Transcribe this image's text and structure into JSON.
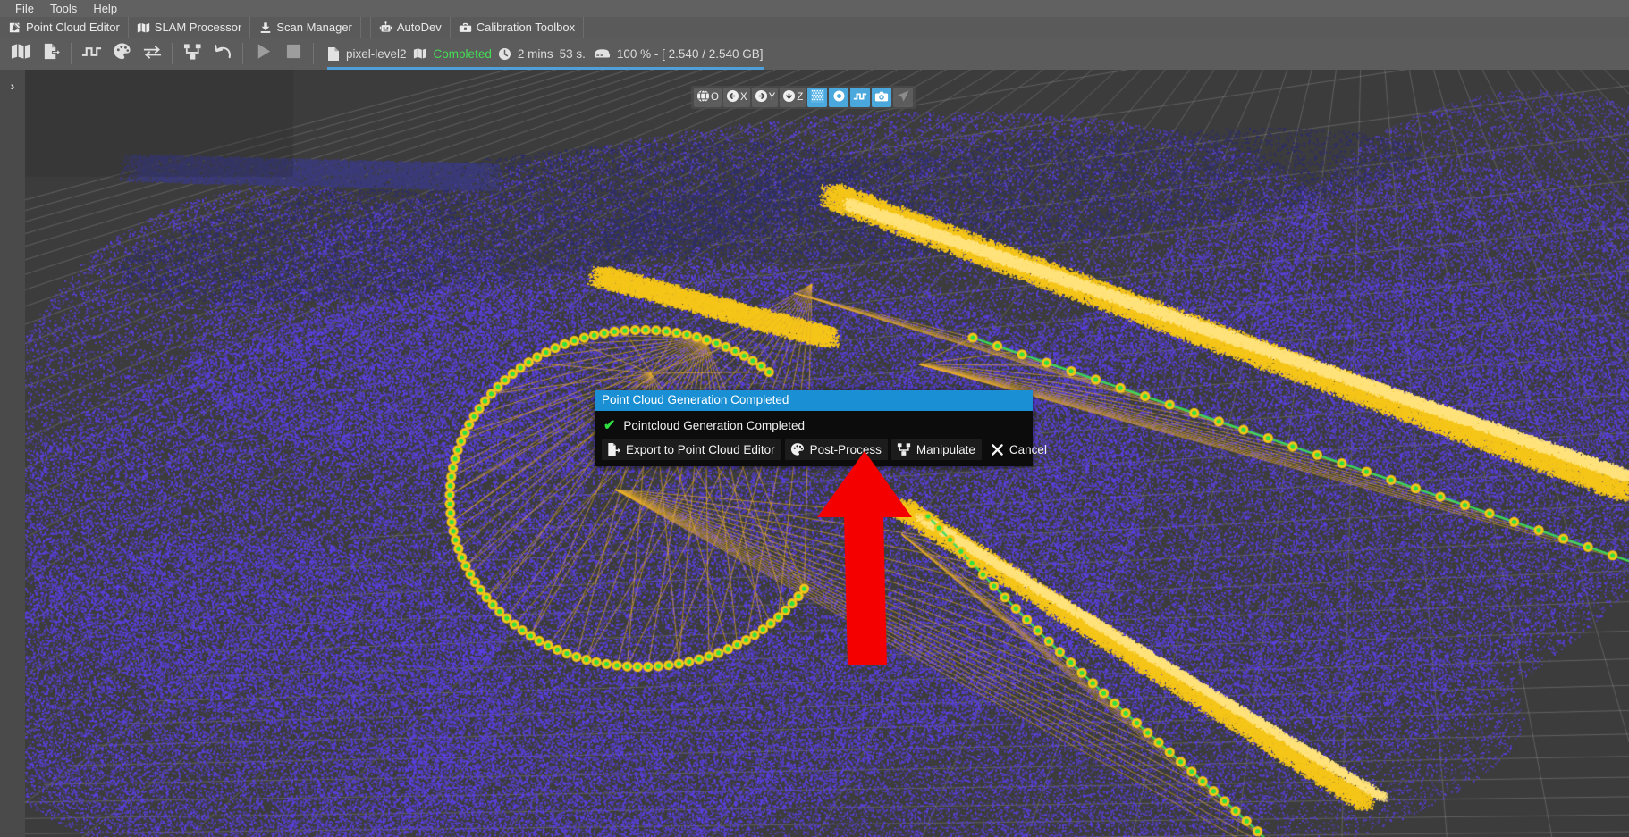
{
  "menubar": {
    "items": [
      {
        "label": "File",
        "name": "menu-file"
      },
      {
        "label": "Tools",
        "name": "menu-tools"
      },
      {
        "label": "Help",
        "name": "menu-help"
      }
    ]
  },
  "tabbar": {
    "tabs": [
      {
        "label": "Point Cloud Editor",
        "icon": "pencil-square-icon",
        "name": "tab-point-cloud-editor"
      },
      {
        "label": "SLAM Processor",
        "icon": "map-icon",
        "name": "tab-slam-processor"
      },
      {
        "label": "Scan Manager",
        "icon": "download-icon",
        "name": "tab-scan-manager"
      },
      {
        "label": "AutoDev",
        "icon": "robot-icon",
        "name": "tab-autodev"
      },
      {
        "label": "Calibration Toolbox",
        "icon": "toolbox-icon",
        "name": "tab-calibration-toolbox"
      }
    ]
  },
  "toolbar": {
    "buttons": [
      {
        "icon": "map-icon",
        "name": "open-map-button"
      },
      {
        "icon": "export-icon",
        "name": "export-button"
      },
      {
        "icon": "waveform-icon",
        "name": "signal-button"
      },
      {
        "icon": "palette-icon",
        "name": "colorize-button"
      },
      {
        "icon": "swap-arrows-icon",
        "name": "swap-button"
      },
      {
        "icon": "tree-branch-icon",
        "name": "graph-button"
      },
      {
        "icon": "undo-icon",
        "name": "undo-button"
      },
      {
        "icon": "play-icon",
        "name": "play-button"
      },
      {
        "icon": "stop-icon",
        "name": "stop-button"
      }
    ],
    "status": {
      "file_icon": "file-icon",
      "file_name": "pixel-level2",
      "state_icon": "map-icon",
      "state_label": "Completed",
      "clock_icon": "clock-icon",
      "elapsed_minutes": "2 mins",
      "elapsed_seconds": "53 s.",
      "memory_icon": "database-icon",
      "memory_label": "100 % - [ 2.540 / 2.540 GB]",
      "progress_percent": 100,
      "progress_color": "#4f9fd8",
      "state_color": "#44dd55"
    }
  },
  "leftpanel": {
    "expander_icon": "chevron-right-icon",
    "expander_label": "›"
  },
  "viewport": {
    "background_color": "#3c3c3c",
    "point_cloud_color": "#5a3fe8",
    "trajectory_color": "#f5c518",
    "node_color": "#2fe043",
    "grid_color": "#8d8d8d"
  },
  "viewctl": {
    "buttons": [
      {
        "label": "O",
        "icon": "globe-icon",
        "state": "dim",
        "name": "view-orbit-button"
      },
      {
        "label": "X",
        "icon": "arrow-left-circle-icon",
        "state": "dim",
        "name": "view-x-button"
      },
      {
        "label": "Y",
        "icon": "arrow-right-circle-icon",
        "state": "dim",
        "name": "view-y-button"
      },
      {
        "label": "Z",
        "icon": "arrow-down-circle-icon",
        "state": "dim",
        "name": "view-z-button"
      },
      {
        "label": "",
        "icon": "grid-dither-icon",
        "state": "active",
        "name": "toggle-grid-button"
      },
      {
        "label": "",
        "icon": "point-circle-icon",
        "state": "active",
        "name": "toggle-points-button"
      },
      {
        "label": "",
        "icon": "waveform-icon",
        "state": "active",
        "name": "toggle-trajectory-button"
      },
      {
        "label": "",
        "icon": "camera-icon",
        "state": "active",
        "name": "screenshot-button"
      },
      {
        "label": "",
        "icon": "cursor-arrow-icon",
        "state": "dim",
        "name": "select-tool-button"
      }
    ]
  },
  "dialog": {
    "title": "Point Cloud Generation Completed",
    "title_bg": "#1a8fd4",
    "message": "Pointcloud Generation Completed",
    "message_icon": "check-icon",
    "buttons": [
      {
        "label": "Export to Point Cloud Editor",
        "icon": "export-icon",
        "name": "export-to-point-cloud-editor-button"
      },
      {
        "label": "Post-Process",
        "icon": "palette-icon",
        "name": "post-process-button"
      },
      {
        "label": "Manipulate",
        "icon": "tree-branch-icon",
        "name": "manipulate-button"
      },
      {
        "label": "Cancel",
        "icon": "close-x-icon",
        "name": "cancel-button"
      }
    ]
  },
  "annotation": {
    "arrow_color": "#f40000",
    "points_to": "post-process-button"
  }
}
